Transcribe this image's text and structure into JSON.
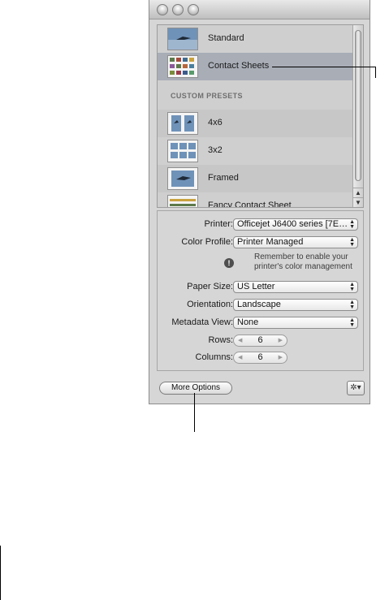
{
  "presets": {
    "standard": [
      {
        "label": "Standard",
        "thumb": "photo-thumbnail"
      },
      {
        "label": "Contact Sheets",
        "thumb": "contact-sheet-thumbnail",
        "selected": true
      }
    ],
    "section_header": "CUSTOM PRESETS",
    "custom": [
      {
        "label": "4x6",
        "thumb": "photo-thumbnail"
      },
      {
        "label": "3x2",
        "thumb": "contact-sheet-thumbnail"
      },
      {
        "label": "Framed",
        "thumb": "photo-thumbnail"
      },
      {
        "label": "Fancy Contact Sheet",
        "thumb": "contact-sheet-thumbnail"
      }
    ]
  },
  "settings": {
    "printer_label": "Printer:",
    "printer_value": "Officejet J6400 series [7E…",
    "color_profile_label": "Color Profile:",
    "color_profile_value": "Printer Managed",
    "note_text": "Remember to enable your printer's color management",
    "paper_size_label": "Paper Size:",
    "paper_size_value": "US Letter",
    "orientation_label": "Orientation:",
    "orientation_value": "Landscape",
    "metadata_view_label": "Metadata View:",
    "metadata_view_value": "None",
    "rows_label": "Rows:",
    "rows_value": "6",
    "columns_label": "Columns:",
    "columns_value": "6"
  },
  "footer": {
    "more_options_label": "More Options"
  },
  "colors": {
    "selection": "#a8adb6",
    "window_bg": "#d6d6d6"
  }
}
